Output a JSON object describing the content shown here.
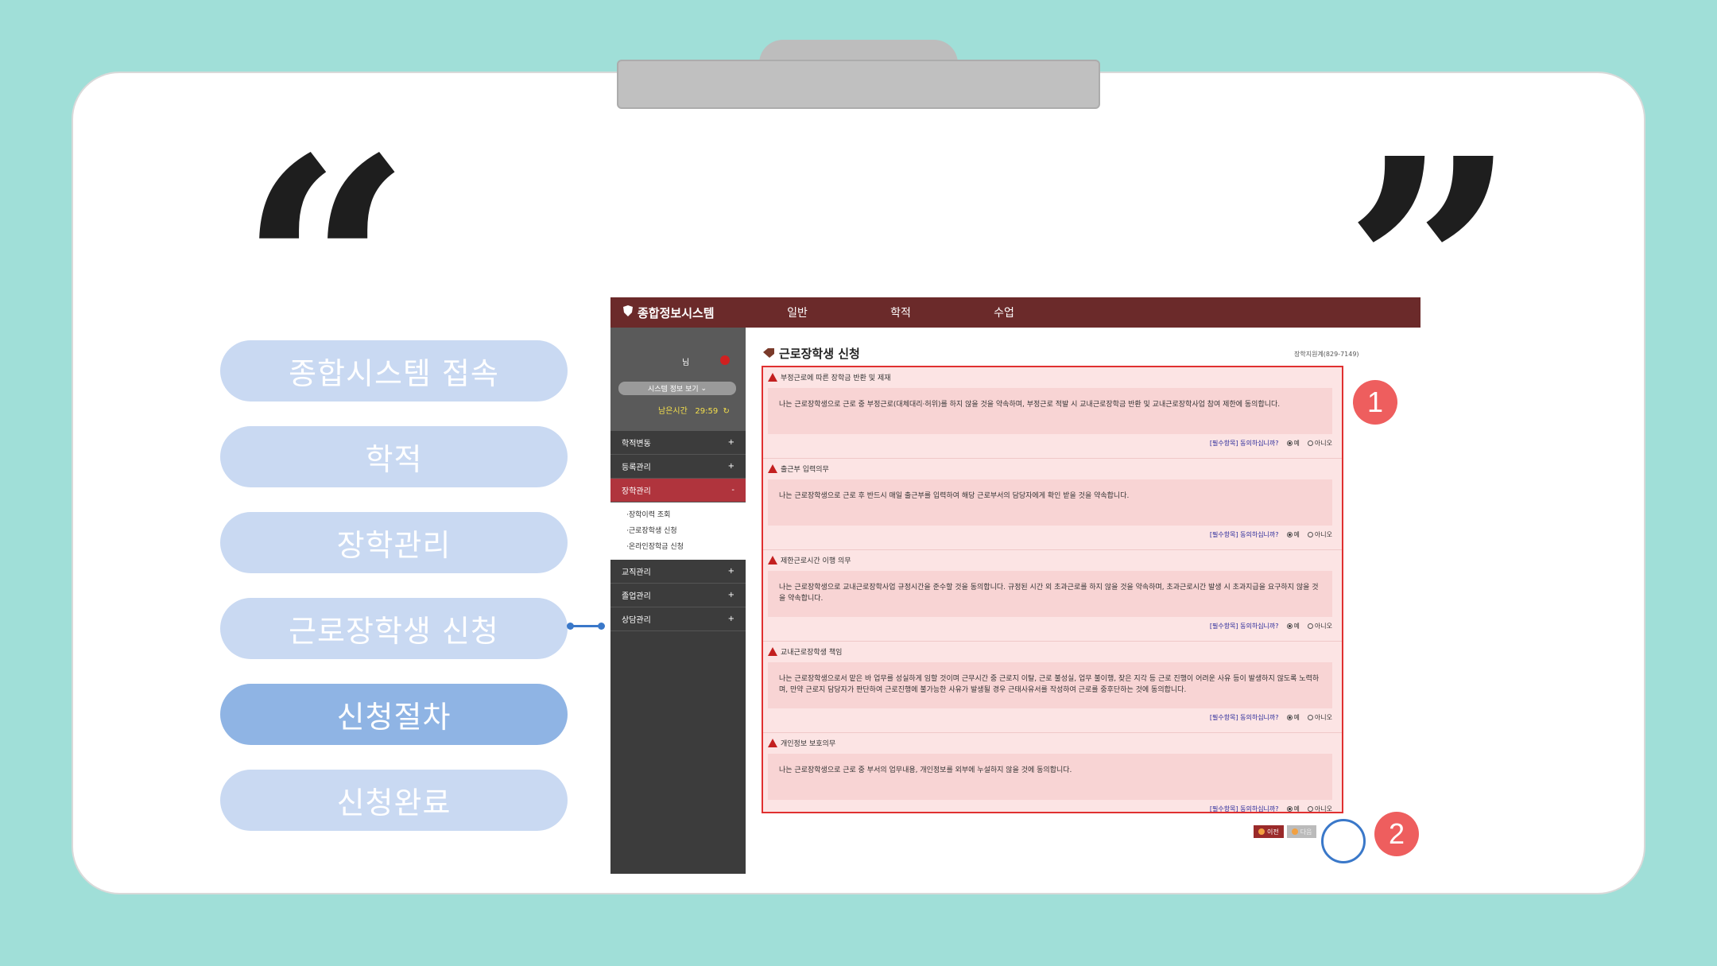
{
  "quotes": {
    "open": "“",
    "close": "”"
  },
  "steps": [
    {
      "label": "종합시스템 접속"
    },
    {
      "label": "학적"
    },
    {
      "label": "장학관리"
    },
    {
      "label": "근로장학생 신청"
    },
    {
      "label": "신청절차"
    },
    {
      "label": "신청완료"
    }
  ],
  "app": {
    "logo": "종합정보시스템",
    "nav": [
      "일반",
      "학적",
      "수업"
    ],
    "profile": {
      "name": "님",
      "select": "시스템 정보 보기",
      "timer_label": "남은시간",
      "timer_value": "29:59"
    },
    "menu": {
      "items": [
        {
          "label": "학적변동",
          "sign": "+"
        },
        {
          "label": "등록관리",
          "sign": "+"
        },
        {
          "label": "장학관리",
          "sign": "-"
        }
      ],
      "sub": [
        "·장학이력 조회",
        "·근로장학생 신청",
        "·온라인장학금 신청"
      ],
      "items2": [
        {
          "label": "교직관리",
          "sign": "+"
        },
        {
          "label": "졸업관리",
          "sign": "+"
        },
        {
          "label": "상담관리",
          "sign": "+"
        }
      ]
    },
    "page_title": "근로장학생 신청",
    "contact": "장학지원계(829-7149)",
    "agree_label": "[필수항목] 동의하십니까?",
    "yes": "예",
    "no": "아니오",
    "sections": [
      {
        "title": "부정근로에 따른 장학금 반환 및 제재",
        "text": "나는 근로장학생으로 근로 중 부정근로(대체대리·허위)를 하지 않을 것을 약속하며, 부정근로 적발 시 교내근로장학금 반환 및 교내근로장학사업 참여 제한에 동의합니다."
      },
      {
        "title": "출근부 입력의무",
        "text": "나는 근로장학생으로 근로 후 반드시 매일 출근부를 입력하여 해당 근로부서의 담당자에게 확인 받을 것을 약속합니다."
      },
      {
        "title": "제한근로시간 이행 의무",
        "text": "나는 근로장학생으로 교내근로장학사업 규정시간을 준수할 것을 동의합니다. 규정된 시간 외 초과근로를 하지 않을 것을 약속하며, 초과근로시간 발생 시 초과지급을 요구하지 않을 것을 약속합니다."
      },
      {
        "title": "교내근로장학생 책임",
        "text": "나는 근로장학생으로서 맡은 바 업무를 성실하게 임할 것이며 근무시간 중 근로지 이탈, 근로 불성실, 업무 불이행, 잦은 지각 등 근로 진행이 어려운 사유 등이 발생하지 않도록 노력하며, 만약 근로지 담당자가 판단하여 근로진행에 불가능한 사유가 발생될 경우 근태사유서를 작성하여 근로를 중후단하는 것에 동의합니다."
      },
      {
        "title": "개인정보 보호의무",
        "text": "나는 근로장학생으로 근로 중 부서의 업무내용, 개인정보를 외부에 누설하지 않을 것에 동의합니다."
      }
    ],
    "buttons": {
      "prev": "이전",
      "next": "다음"
    }
  },
  "markers": [
    "1",
    "2"
  ],
  "colors": {
    "background": "#a0dfd8",
    "step": "#c9d9f2",
    "step_active": "#8fb4e4",
    "topbar": "#6b2a2a",
    "highlight": "#e03030",
    "marker": "#ee5e5e",
    "ring": "#3a78c9"
  }
}
